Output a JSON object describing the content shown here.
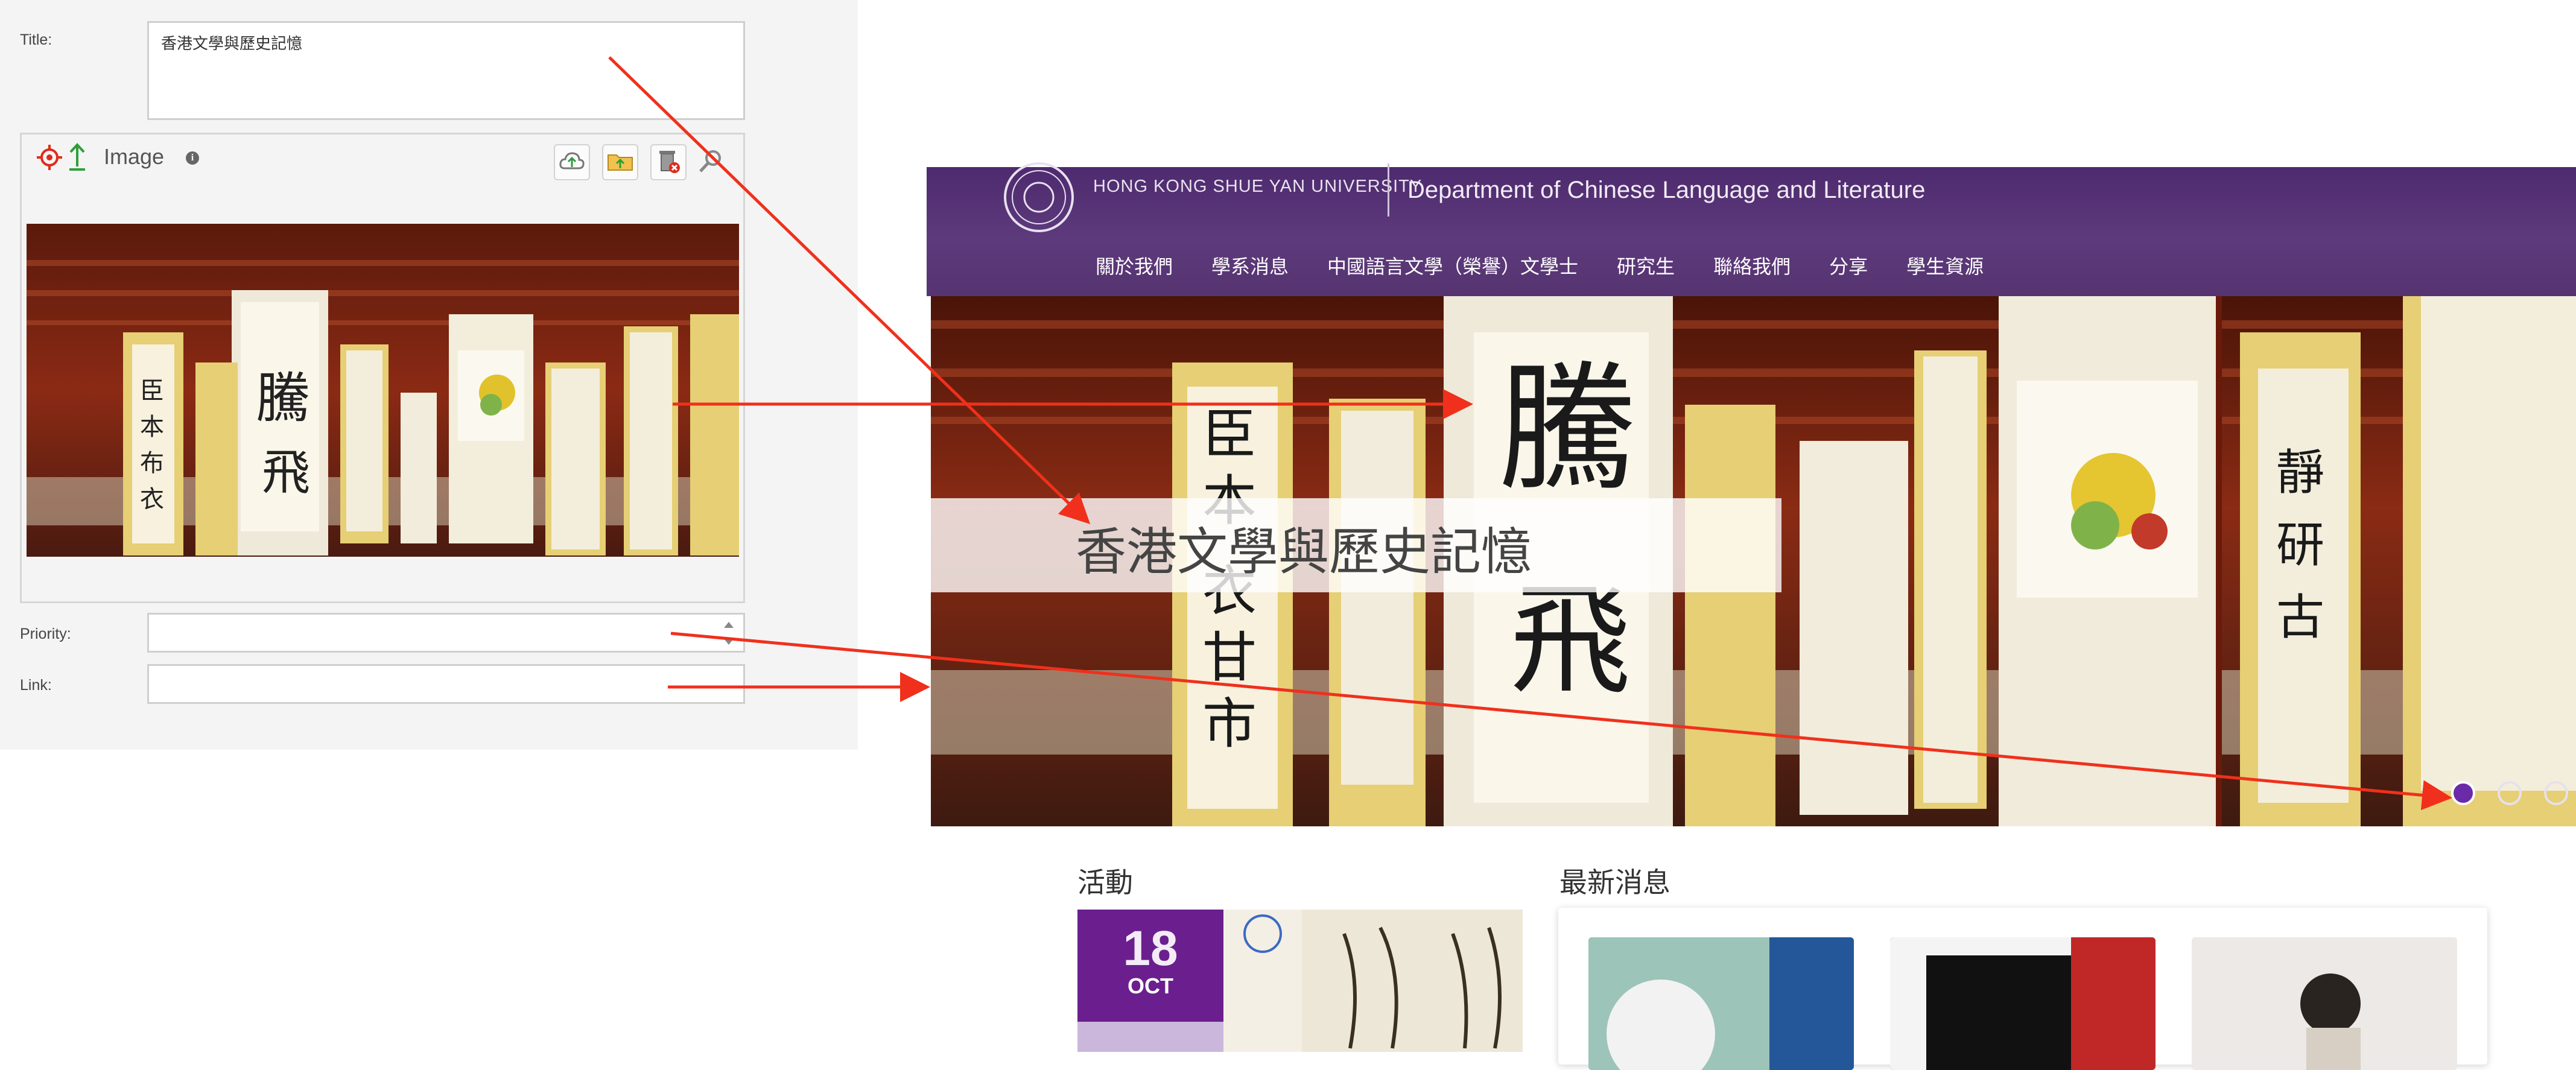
{
  "cms_form": {
    "title_label": "Title:",
    "title_value": "香港文學與歷史記憶",
    "image_section": {
      "label": "Image",
      "icons": [
        "target-icon",
        "upload-arrow-icon",
        "info-icon",
        "cloud-upload-icon",
        "folder-icon",
        "delete-icon",
        "magnifier-icon"
      ]
    },
    "priority_label": "Priority:",
    "priority_value": "",
    "link_label": "Link:",
    "link_value": ""
  },
  "site": {
    "university_en": "HONG KONG SHUE YAN UNIVERSITY",
    "department": "Department of Chinese Language and Literature",
    "nav": [
      "關於我們",
      "學系消息",
      "中國語言文學（榮譽）文學士",
      "研究生",
      "聯絡我們",
      "分享",
      "學生資源"
    ],
    "banner_caption": "香港文學與歷史記憶",
    "carousel_dots": 3,
    "carousel_active": 1,
    "sections": {
      "events_title": "活動",
      "news_title": "最新消息"
    },
    "event": {
      "day": "18",
      "month": "OCT"
    }
  },
  "colors": {
    "brand_purple": "#5d3a7c",
    "arrow_red": "#f0301c",
    "panel_bg": "#f4f4f4"
  }
}
